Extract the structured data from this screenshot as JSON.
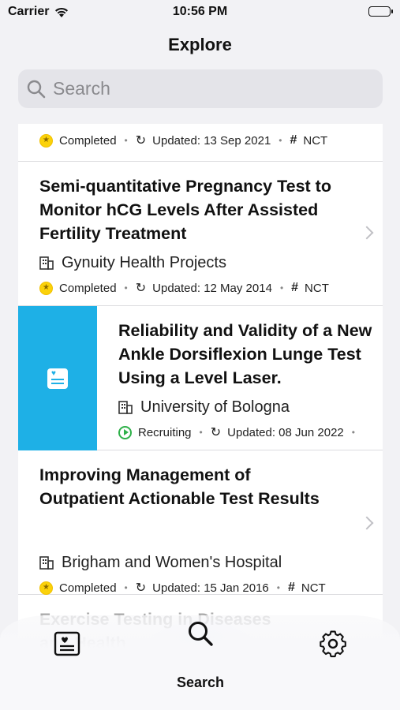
{
  "status_bar": {
    "carrier": "Carrier",
    "time": "10:56 PM"
  },
  "nav": {
    "title": "Explore"
  },
  "search": {
    "placeholder": "Search"
  },
  "cards": [
    {
      "title": "",
      "organization": "",
      "status": "Completed",
      "updated": "Updated: 13 Sep 2021",
      "id_prefix": "NCT"
    },
    {
      "title": "Semi-quantitative Pregnancy Test to Monitor hCG Levels After Assisted Fertility Treatment",
      "organization": "Gynuity Health Projects",
      "status": "Completed",
      "updated": "Updated: 12 May 2014",
      "id_prefix": "NCT"
    },
    {
      "title": "Reliability and Validity of a New Ankle Dorsiflexion Lunge Test Using a Level Laser.",
      "organization": "University of Bologna",
      "status": "Recruiting",
      "updated": "Updated: 08 Jun 2022",
      "id_prefix": ""
    },
    {
      "title": "Improving Management of Outpatient Actionable Test Results",
      "organization": "Brigham and Women's Hospital",
      "status": "Completed",
      "updated": "Updated: 15 Jan 2016",
      "id_prefix": "NCT"
    },
    {
      "title": "Exercise Testing in Diseases and Health",
      "organization": "",
      "status": "",
      "updated": "",
      "id_prefix": ""
    }
  ],
  "tab_bar": {
    "tabs": [
      {
        "label": "",
        "icon": "health-record-icon"
      },
      {
        "label": "Search",
        "icon": "search-icon"
      },
      {
        "label": "",
        "icon": "gear-icon"
      }
    ]
  },
  "colors": {
    "accent_thumbnail": "#1eb0e6",
    "status_completed": "#fbd20a",
    "status_recruiting": "#2fb14a"
  }
}
